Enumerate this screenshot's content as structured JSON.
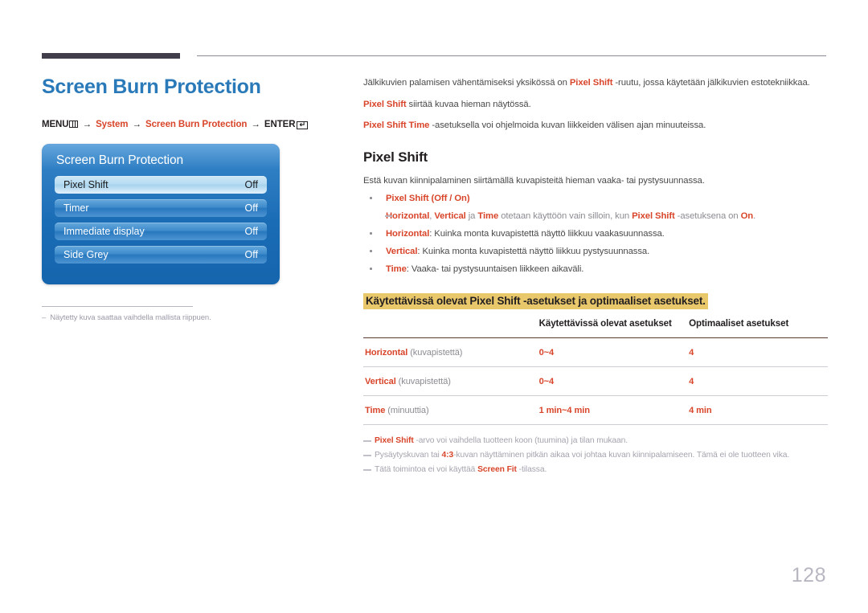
{
  "page": {
    "title": "Screen Burn Protection",
    "number": "128"
  },
  "breadcrumb": {
    "menu_label": "MENU",
    "menu_icon": "menu-grid-icon",
    "arrow": "→",
    "item1": "System",
    "item2": "Screen Burn Protection",
    "enter_label": "ENTER",
    "enter_icon": "enter-key-icon"
  },
  "osd": {
    "title": "Screen Burn Protection",
    "rows": [
      {
        "label": "Pixel Shift",
        "value": "Off",
        "selected": true
      },
      {
        "label": "Timer",
        "value": "Off",
        "selected": false
      },
      {
        "label": "Immediate display",
        "value": "Off",
        "selected": false
      },
      {
        "label": "Side Grey",
        "value": "Off",
        "selected": false
      }
    ]
  },
  "left_footnote": {
    "dash": "–",
    "text": "Näytetty kuva saattaa vaihdella mallista riippuen."
  },
  "intro": {
    "p1_a": "Jälkikuvien palamisen vähentämiseksi yksikössä on ",
    "p1_b": "Pixel Shift",
    "p1_c": " -ruutu, jossa käytetään jälkikuvien estotekniikkaa.",
    "p2_a": "Pixel Shift",
    "p2_b": " siirtää kuvaa hieman näytössä.",
    "p3_a": "Pixel Shift Time",
    "p3_b": " -asetuksella voi ohjelmoida kuvan liikkeiden välisen ajan minuuteissa."
  },
  "section": {
    "title": "Pixel Shift",
    "lead": "Estä kuvan kiinnipalaminen siirtämällä kuvapisteitä hieman vaaka- tai pystysuunnassa."
  },
  "bullets": {
    "b1_name": "Pixel Shift",
    "b1_rest": " (Off / On)",
    "note_a": "Horizontal",
    "note_b": ", ",
    "note_c": "Vertical",
    "note_d": " ja ",
    "note_e": "Time",
    "note_f": " otetaan käyttöön vain silloin, kun ",
    "note_g": "Pixel Shift",
    "note_h": " -asetuksena on ",
    "note_i": "On",
    "note_j": ".",
    "b2_name": "Horizontal",
    "b2_rest": ": Kuinka monta kuvapistettä näyttö liikkuu vaakasuunnassa.",
    "b3_name": "Vertical",
    "b3_rest": ": Kuinka monta kuvapistettä näyttö liikkuu pystysuunnassa.",
    "b4_name": "Time",
    "b4_rest": ": Vaaka- tai pystysuuntaisen liikkeen aikaväli."
  },
  "table": {
    "heading": "Käytettävissä olevat Pixel Shift -asetukset ja optimaaliset asetukset.",
    "columns": [
      "",
      "Käytettävissä olevat asetukset",
      "Optimaaliset asetukset"
    ],
    "rows": [
      {
        "name": "Horizontal",
        "unit": " (kuvapistettä)",
        "available": "0~4",
        "optimal": "4"
      },
      {
        "name": "Vertical",
        "unit": " (kuvapistettä)",
        "available": "0~4",
        "optimal": "4"
      },
      {
        "name": "Time",
        "unit": " (minuuttia)",
        "available": "1 min~4 min",
        "optimal": "4 min"
      }
    ]
  },
  "footnotes": {
    "f1_a": "Pixel Shift",
    "f1_b": " -arvo voi vaihdella tuotteen koon (tuumina) ja tilan mukaan.",
    "f2_a": "Pysäytyskuvan tai ",
    "f2_b": "4:3",
    "f2_c": "-kuvan näyttäminen pitkän aikaa voi johtaa kuvan kiinnipalamiseen. Tämä ei ole tuotteen vika.",
    "f3_a": "Tätä toimintoa ei voi käyttää ",
    "f3_b": "Screen Fit",
    "f3_c": " -tilassa."
  },
  "colors": {
    "accent_blue": "#2a7ab9",
    "accent_red": "#d8452a",
    "highlight_yellow": "#e9c86b",
    "osd_blue": "#1a6cb5",
    "muted_grey": "#8d8b92"
  }
}
